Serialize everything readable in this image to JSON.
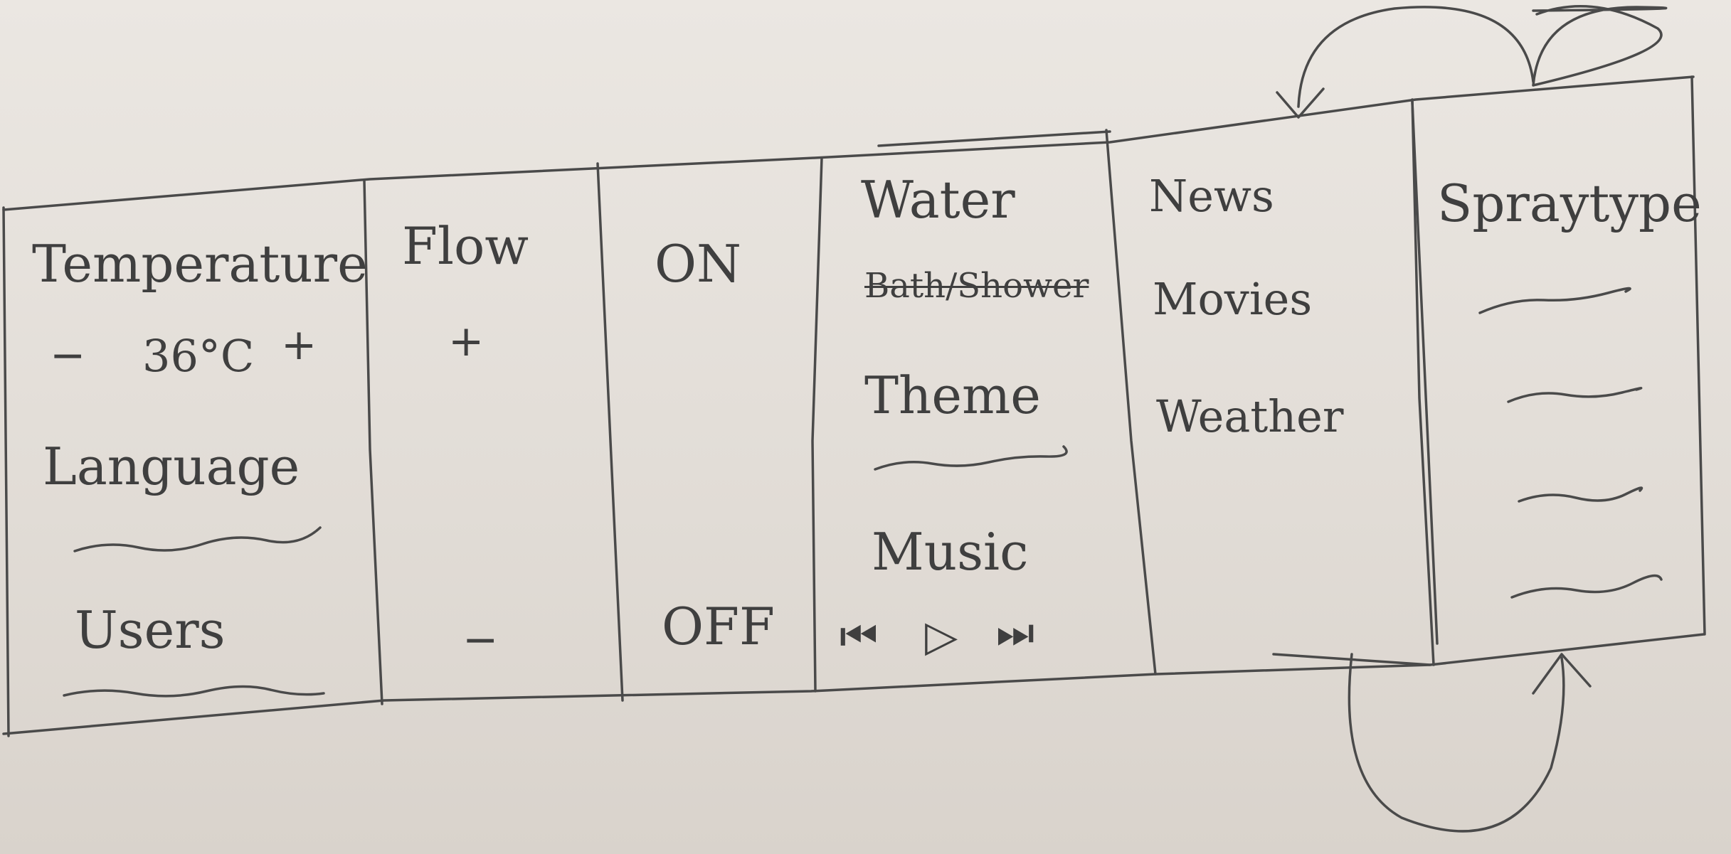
{
  "panel1": {
    "temperature_label": "Temperature",
    "temp_minus": "−",
    "temp_value": "36°C",
    "temp_plus": "+",
    "language_label": "Language",
    "users_label": "Users"
  },
  "panel2": {
    "flow_label": "Flow",
    "flow_plus": "+",
    "flow_minus": "−"
  },
  "panel3": {
    "on_label": "ON",
    "off_label": "OFF"
  },
  "panel4": {
    "water_label": "Water",
    "bath_shower_label": "Bath/Shower",
    "theme_label": "Theme",
    "music_label": "Music",
    "prev_symbol": "⏮",
    "play_symbol": "▷",
    "next_symbol": "⏭"
  },
  "panel5": {
    "news_label": "News",
    "movies_label": "Movies",
    "weather_label": "Weather"
  },
  "panel6": {
    "spray_type_label": "Spraytype"
  },
  "icons": {
    "prev": "skip-back-icon",
    "play": "play-icon",
    "next": "skip-forward-icon"
  }
}
